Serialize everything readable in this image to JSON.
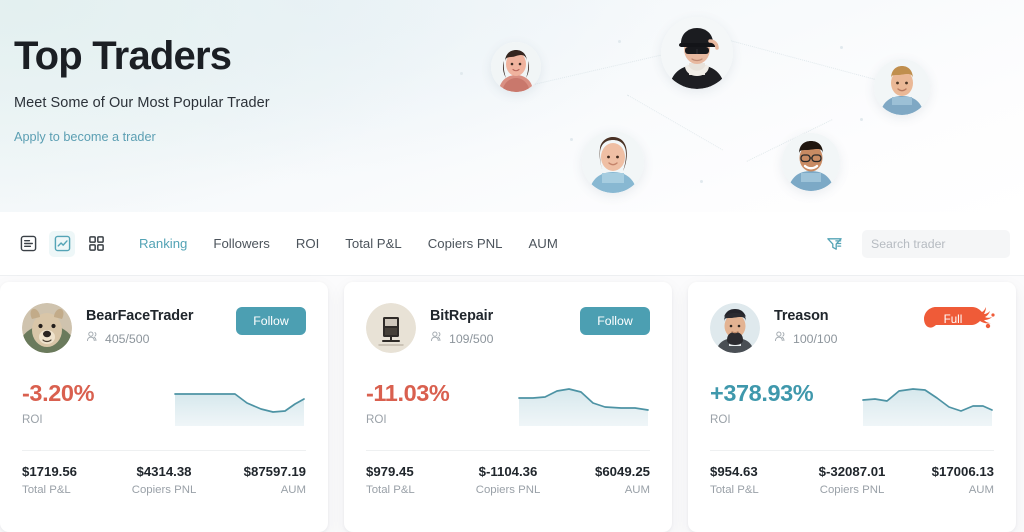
{
  "hero": {
    "title": "Top Traders",
    "subtitle": "Meet Some of Our Most Popular Trader",
    "link_label": "Apply to become a trader"
  },
  "toolbar": {
    "view_icons": [
      {
        "name": "list-view-icon",
        "active": false
      },
      {
        "name": "chart-view-icon",
        "active": true
      },
      {
        "name": "grid-view-icon",
        "active": false
      }
    ],
    "tabs": [
      {
        "label": "Ranking",
        "active": true
      },
      {
        "label": "Followers",
        "active": false
      },
      {
        "label": "ROI",
        "active": false
      },
      {
        "label": "Total P&L",
        "active": false
      },
      {
        "label": "Copiers PNL",
        "active": false
      },
      {
        "label": "AUM",
        "active": false
      }
    ],
    "filter_icon": "filter-icon",
    "search": {
      "value": "",
      "placeholder": "Search trader",
      "icon": "search-icon"
    }
  },
  "colors": {
    "accent_teal": "#4c9fb2",
    "positive": "#3f98ac",
    "negative": "#d9604f",
    "full_badge": "#ef5b38",
    "tab_active": "#53a3b5",
    "link": "#5c9fb3"
  },
  "cards": [
    {
      "name": "BearFaceTrader",
      "followers": "405/500",
      "action": {
        "type": "follow",
        "label": "Follow"
      },
      "roi": {
        "value": "-3.20%",
        "label": "ROI",
        "sign": "neg"
      },
      "sparkline": [
        30,
        30,
        30,
        30,
        30,
        31,
        35,
        38,
        38,
        36,
        30
      ],
      "stats": [
        {
          "value": "$1719.56",
          "label": "Total P&L"
        },
        {
          "value": "$4314.38",
          "label": "Copiers PNL"
        },
        {
          "value": "$87597.19",
          "label": "AUM"
        }
      ]
    },
    {
      "name": "BitRepair",
      "followers": "109/500",
      "action": {
        "type": "follow",
        "label": "Follow"
      },
      "roi": {
        "value": "-11.03%",
        "label": "ROI",
        "sign": "neg"
      },
      "sparkline": [
        28,
        27,
        22,
        17,
        18,
        26,
        33,
        34,
        34,
        34,
        33
      ],
      "stats": [
        {
          "value": "$979.45",
          "label": "Total P&L"
        },
        {
          "value": "$-1104.36",
          "label": "Copiers PNL"
        },
        {
          "value": "$6049.25",
          "label": "AUM"
        }
      ]
    },
    {
      "name": "Treason",
      "followers": "100/100",
      "action": {
        "type": "full",
        "label": "Full"
      },
      "roi": {
        "value": "+378.93%",
        "label": "ROI",
        "sign": "pos"
      },
      "sparkline": [
        26,
        27,
        18,
        14,
        16,
        26,
        33,
        35,
        31,
        28,
        32
      ],
      "stats": [
        {
          "value": "$954.63",
          "label": "Total P&L"
        },
        {
          "value": "$-32087.01",
          "label": "Copiers PNL"
        },
        {
          "value": "$17006.13",
          "label": "AUM"
        }
      ]
    }
  ]
}
